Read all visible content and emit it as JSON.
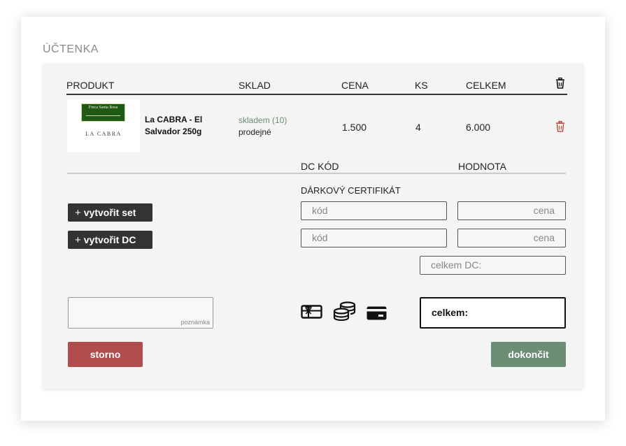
{
  "receipt": {
    "title": "ÚČTENKA"
  },
  "table": {
    "headers": {
      "product": "PRODUKT",
      "stock": "SKLAD",
      "price": "CENA",
      "qty": "KS",
      "total": "CELKEM"
    },
    "rows": [
      {
        "thumb_label": "Finca Santa Rosa",
        "thumb_brand": "LA CABRA",
        "name": "La CABRA - El Salvador 250g",
        "stock_status": "skladem (10)",
        "sellable": "prodejné",
        "price": "1.500",
        "qty": "4",
        "total": "6.000"
      }
    ]
  },
  "dc": {
    "col_code": "DC KÓD",
    "col_value": "HODNOTA",
    "section_label": "DÁRKOVÝ CERTIFIKÁT",
    "rows": [
      {
        "code_placeholder": "kód",
        "price_placeholder": "cena"
      },
      {
        "code_placeholder": "kód",
        "price_placeholder": "cena"
      }
    ],
    "total_placeholder": "celkem DC:"
  },
  "actions": {
    "create_set": "vytvořit set",
    "create_dc": "vytvořit DC",
    "plus_symbol": "+"
  },
  "note": {
    "placeholder": "poznámka"
  },
  "payment": {
    "icons": [
      "gift-card-icon",
      "coins-icon",
      "credit-card-icon"
    ]
  },
  "summary": {
    "total_label": "celkem:"
  },
  "buttons": {
    "cancel": "storno",
    "finish": "dokončit"
  },
  "colors": {
    "stock_ok": "#6d8d73",
    "cancel": "#b24d4d",
    "finish": "#6b8e75",
    "delete": "#c0392b",
    "dark_button": "#333333"
  }
}
